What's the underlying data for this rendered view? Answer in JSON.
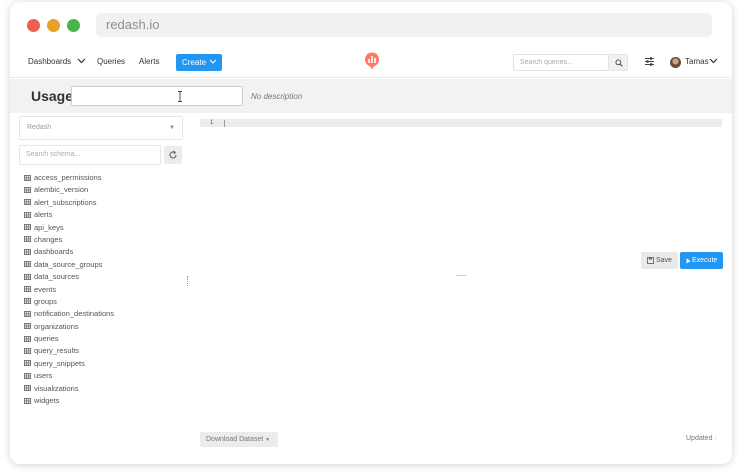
{
  "browser": {
    "url": "redash.io"
  },
  "nav": {
    "dashboards": "Dashboards",
    "queries": "Queries",
    "alerts": "Alerts",
    "create": "Create",
    "search_placeholder": "Search queries...",
    "user_name": "Tamas"
  },
  "query": {
    "title": "Usage",
    "title_input_value": "",
    "description": "No description"
  },
  "schema": {
    "data_source": "Redash",
    "search_placeholder": "Search schema...",
    "tables": [
      "access_permissions",
      "alembic_version",
      "alert_subscriptions",
      "alerts",
      "api_keys",
      "changes",
      "dashboards",
      "data_source_groups",
      "data_sources",
      "events",
      "groups",
      "notification_destinations",
      "organizations",
      "queries",
      "query_results",
      "query_snippets",
      "users",
      "visualizations",
      "widgets"
    ]
  },
  "editor": {
    "line_number": "1",
    "save_label": "Save",
    "execute_label": "Execute"
  },
  "footer": {
    "download_label": "Download Dataset",
    "updated_label": "Updated"
  },
  "colors": {
    "primary": "#2196f3",
    "logo": "#ff7964",
    "titlebar_bg": "#f0f2f4"
  },
  "icons": {
    "window_controls": [
      "close-dot",
      "minimize-dot",
      "maximize-dot"
    ],
    "search": "search-icon",
    "settings": "sliders-icon",
    "refresh": "refresh-icon",
    "table": "table-icon",
    "save": "floppy-icon",
    "execute": "play-icon"
  }
}
